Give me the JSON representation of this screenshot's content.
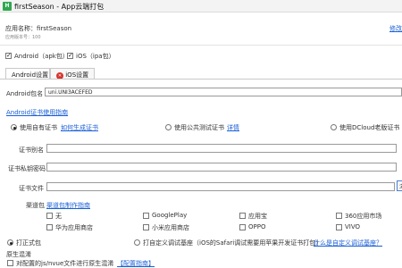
{
  "window": {
    "title": "firstSeason - App云端打包",
    "icon": "app-icon"
  },
  "app_info": {
    "name_label": "应用名称：firstSeason",
    "version_label": "应用版本号：100",
    "modify_link": "修改"
  },
  "platforms": {
    "android": "Android（apk包）",
    "ios": "iOS（ipa包）"
  },
  "tabs": {
    "android": "Android设置",
    "ios": "iOS设置"
  },
  "package": {
    "label": "Android包名",
    "value": "uni.UNI3ACEFED"
  },
  "cert_guide_link": "Android证书使用指南",
  "cert_options": {
    "own": "使用自有证书",
    "how_generate": "如何生成证书",
    "public": "使用公共测试证书",
    "details": "详情",
    "old": "使用DCloud老版证书"
  },
  "cert_fields": {
    "alias": "证书别名",
    "password": "证书私钥密码",
    "file": "证书文件",
    "browse": "浏览"
  },
  "channels": {
    "label": "渠道包",
    "guide_link": "渠道包制作指南",
    "items": [
      "无",
      "GooglePlay",
      "应用宝",
      "360应用市场",
      "华为应用商店",
      "小米应用商店",
      "OPPO",
      "VIVO"
    ]
  },
  "build_mode": {
    "release": "打正式包",
    "custom_base": "打自定义调试基座（iOS的Safari调试需要用苹果开发证书打包）",
    "what_is": "什么是自定义调试基座？"
  },
  "native_obfuscation": {
    "title": "原生混淆",
    "label": "对配置的js/nvue文件进行原生混淆",
    "link": "【配置指南】"
  }
}
